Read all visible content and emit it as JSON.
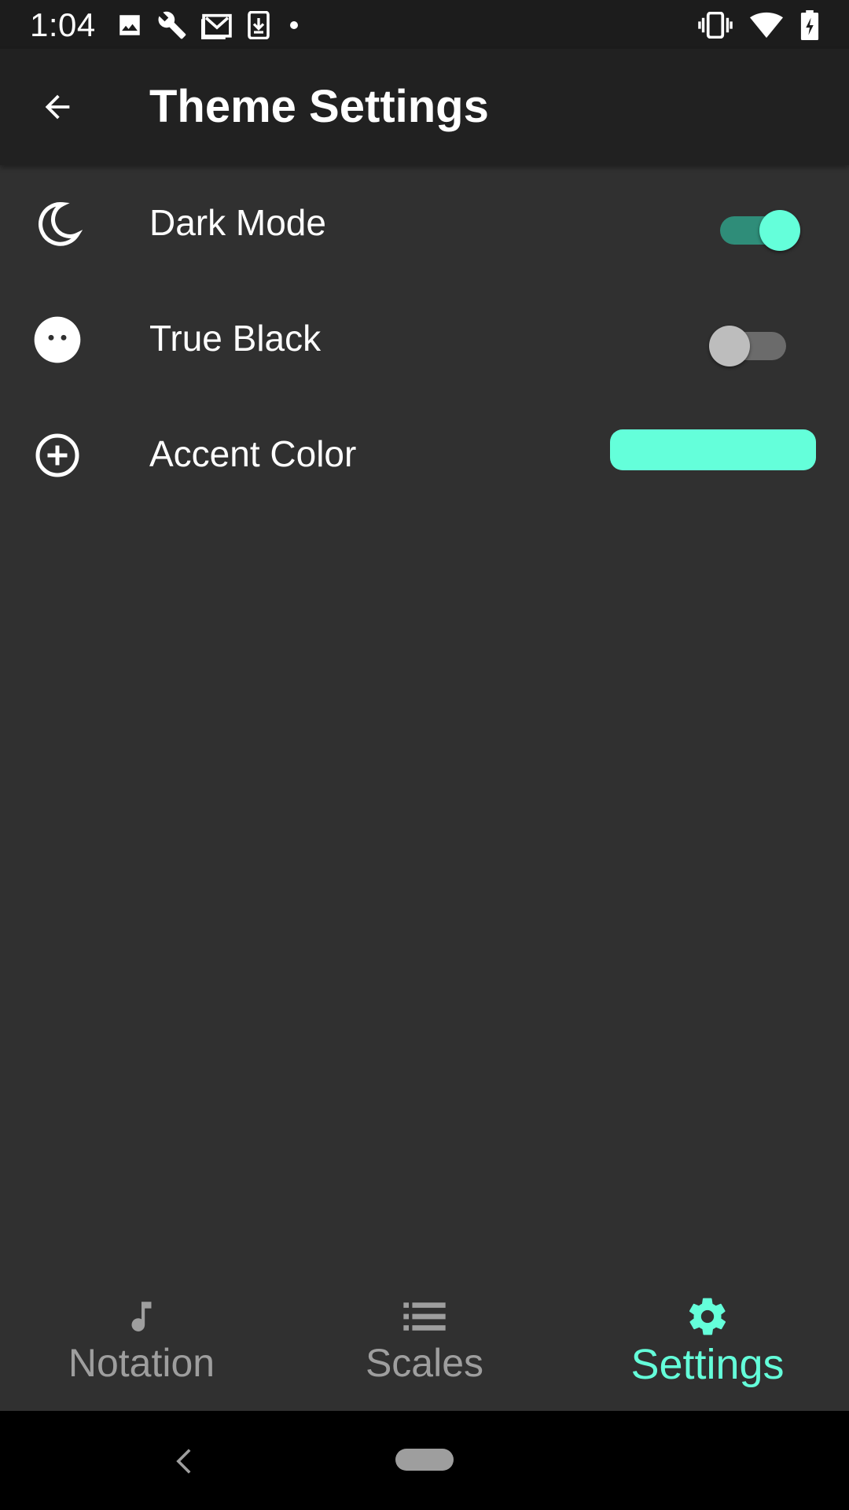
{
  "status_bar": {
    "time": "1:04",
    "left_icons": [
      "image-icon",
      "wrench-icon",
      "mail-icon",
      "download-icon",
      "dot-icon"
    ],
    "right_icons": [
      "vibrate-icon",
      "wifi-icon",
      "battery-charging-icon"
    ]
  },
  "app_bar": {
    "title": "Theme Settings",
    "back_icon": "arrow-back-icon"
  },
  "settings": [
    {
      "label": "Dark Mode",
      "icon": "moon-icon",
      "control": "toggle",
      "checked": true
    },
    {
      "label": "True Black",
      "icon": "face-icon",
      "control": "toggle",
      "checked": false
    },
    {
      "label": "Accent Color",
      "icon": "add-circle-icon",
      "control": "color-swatch",
      "value": "#64FFDA"
    }
  ],
  "bottom_nav": {
    "items": [
      {
        "label": "Notation",
        "icon": "music-note-icon",
        "active": false
      },
      {
        "label": "Scales",
        "icon": "list-icon",
        "active": false
      },
      {
        "label": "Settings",
        "icon": "gear-icon",
        "active": true
      }
    ]
  },
  "colors": {
    "accent": "#64FFDA",
    "background": "#303030",
    "app_bar": "#212121",
    "status_bar": "#1C1C1C",
    "inactive": "#9E9E9E"
  }
}
